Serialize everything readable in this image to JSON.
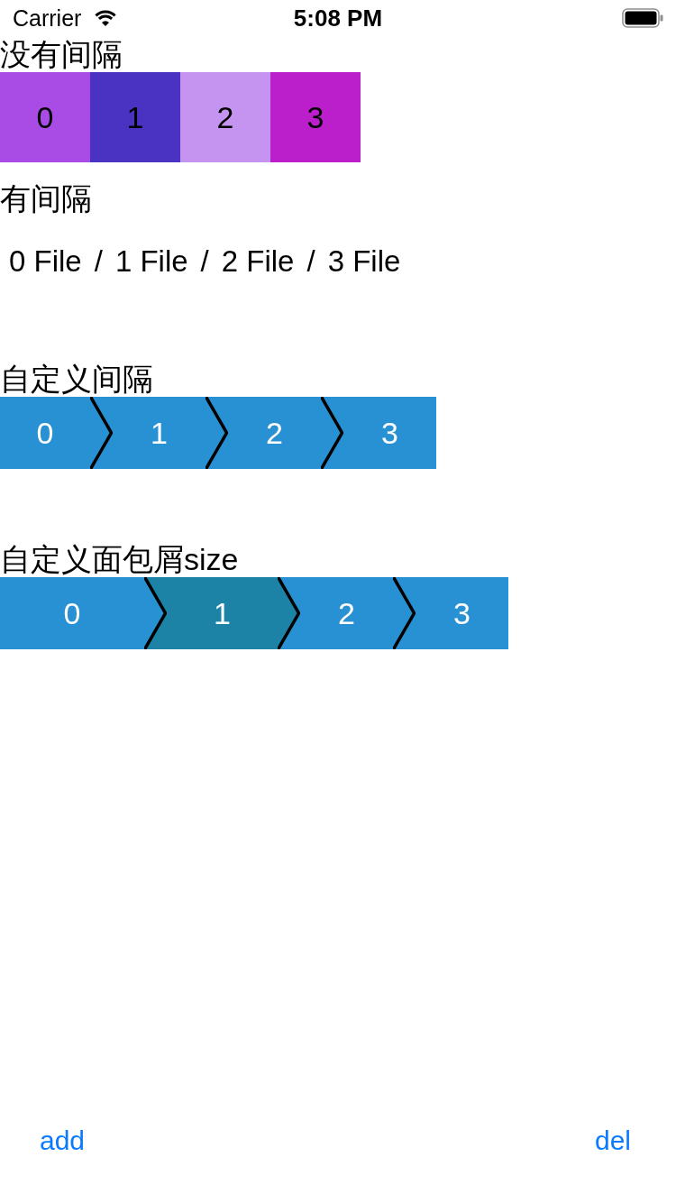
{
  "status_bar": {
    "carrier": "Carrier",
    "time": "5:08 PM"
  },
  "sections": [
    {
      "kind": "tiles",
      "title": "没有间隔",
      "items": [
        {
          "label": "0",
          "color": "#a94ce6"
        },
        {
          "label": "1",
          "color": "#4a33c2"
        },
        {
          "label": "2",
          "color": "#c594f1"
        },
        {
          "label": "3",
          "color": "#bb1fcb"
        }
      ]
    },
    {
      "kind": "text",
      "title": "有间隔",
      "items": [
        {
          "label": "0 File",
          "separator": "/"
        },
        {
          "label": "1 File",
          "separator": "/"
        },
        {
          "label": "2 File",
          "separator": "/"
        },
        {
          "label": "3 File"
        }
      ]
    },
    {
      "kind": "chevrons",
      "title": "自定义间隔",
      "items": [
        {
          "label": "0",
          "selected": false
        },
        {
          "label": "1",
          "selected": false
        },
        {
          "label": "2",
          "selected": false
        },
        {
          "label": "3",
          "selected": false
        }
      ]
    },
    {
      "kind": "sized-chevrons",
      "title": "自定义面包屑size",
      "items": [
        {
          "label": "0",
          "selected": false
        },
        {
          "label": "1",
          "selected": true
        },
        {
          "label": "2",
          "selected": false
        },
        {
          "label": "3",
          "selected": false
        }
      ]
    }
  ],
  "buttons": [
    {
      "label": "add"
    },
    {
      "label": "del"
    }
  ]
}
